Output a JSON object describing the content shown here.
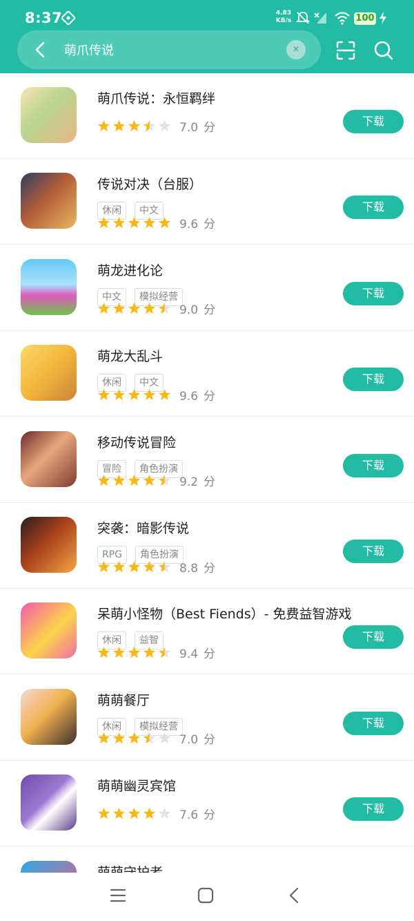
{
  "status_bar": {
    "time": "8:37",
    "network_speed_value": "4.83",
    "network_speed_unit": "KB/s",
    "battery": "100"
  },
  "search": {
    "query": "萌爪传说",
    "clear_label": "×"
  },
  "download_label": "下载",
  "score_unit": "分",
  "colors": {
    "accent": "#22bca4",
    "search_box": "#4ecbb6",
    "star": "#f8b818",
    "star_empty": "#e2e2e2"
  },
  "apps": [
    {
      "name": "萌爪传说：永恒羁绊",
      "tags": [],
      "stars": 3.5,
      "score": "7.0"
    },
    {
      "name": "传说对决（台服）",
      "tags": [
        "休闲",
        "中文"
      ],
      "stars": 5,
      "score": "9.6"
    },
    {
      "name": "萌龙进化论",
      "tags": [
        "中文",
        "模拟经营"
      ],
      "stars": 4.5,
      "score": "9.0"
    },
    {
      "name": "萌龙大乱斗",
      "tags": [
        "休闲",
        "中文"
      ],
      "stars": 5,
      "score": "9.6"
    },
    {
      "name": "移动传说冒险",
      "tags": [
        "冒险",
        "角色扮演"
      ],
      "stars": 4.5,
      "score": "9.2"
    },
    {
      "name": "突袭：暗影传说",
      "tags": [
        "RPG",
        "角色扮演"
      ],
      "stars": 4.5,
      "score": "8.8"
    },
    {
      "name": "呆萌小怪物（Best Fiends）- 免费益智游戏",
      "tags": [
        "休闲",
        "益智"
      ],
      "stars": 4.5,
      "score": "9.4"
    },
    {
      "name": "萌萌餐厅",
      "tags": [
        "休闲",
        "模拟经营"
      ],
      "stars": 3.5,
      "score": "7.0"
    },
    {
      "name": "萌萌幽灵宾馆",
      "tags": [],
      "stars": 4,
      "score": "7.6"
    },
    {
      "name": "萌萌守护者",
      "tags": [],
      "stars": 0,
      "score": ""
    }
  ]
}
